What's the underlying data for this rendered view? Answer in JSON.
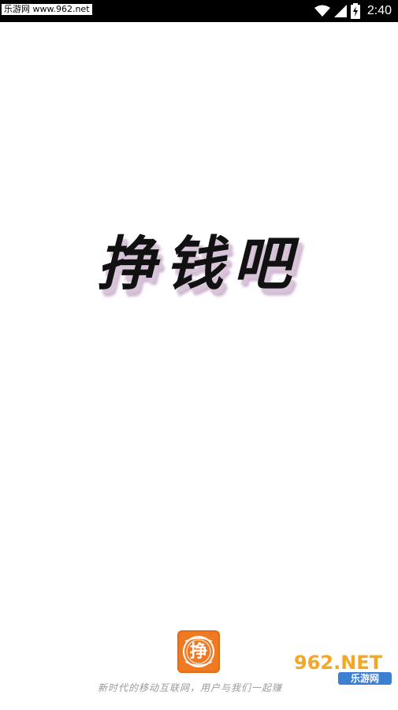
{
  "status_bar": {
    "watermark": "乐游网 www.962.net",
    "time": "2:40",
    "icons": [
      "wifi-icon",
      "signal-icon",
      "battery-charging-icon"
    ]
  },
  "splash": {
    "title": "挣钱吧",
    "logo_char": "挣",
    "slogan": "新时代的移动互联网，用户与我们一起赚"
  },
  "watermark_bottom": {
    "main": "962.NET",
    "sub": "乐游网"
  },
  "colors": {
    "logo_orange": "#f07a22",
    "title_shadow": "#d8c4d8",
    "watermark_orange": "#f5a623",
    "watermark_blue": "#3d7fd1"
  }
}
